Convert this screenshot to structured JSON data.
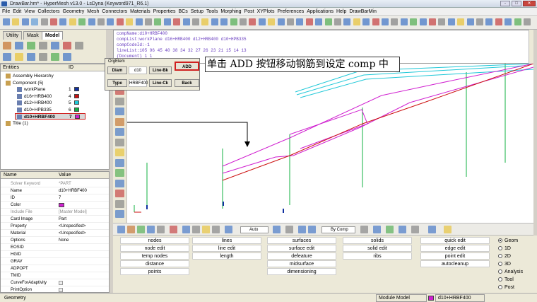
{
  "window": {
    "title": "DrawBar.hm* - HyperMesh v13.0 - LsDyna (Keyword971_R6.1)",
    "buttons": [
      "-",
      "□",
      "✕"
    ]
  },
  "menu": [
    "File",
    "Edit",
    "View",
    "Collectors",
    "Geometry",
    "Mesh",
    "Connectors",
    "Materials",
    "Properties",
    "BCs",
    "Setup",
    "Tools",
    "Morphing",
    "Post",
    "XYPlots",
    "Preferences",
    "Applications",
    "Help",
    "DrawBarMin"
  ],
  "left_tabs": [
    "Utility",
    "Mask",
    "Model"
  ],
  "entities": {
    "header": "Entities",
    "id_header": "ID",
    "items": [
      {
        "label": "Assembly Hierarchy",
        "id": "",
        "color": ""
      },
      {
        "label": "Component (5)",
        "id": "",
        "color": ""
      },
      {
        "label": "workPlane",
        "id": "1",
        "color": "#1030a0"
      },
      {
        "label": "d16+HRB400",
        "id": "4",
        "color": "#cc1010"
      },
      {
        "label": "d12+HRB400",
        "id": "5",
        "color": "#20c8d8"
      },
      {
        "label": "d10+HPB335",
        "id": "6",
        "color": "#10b040"
      },
      {
        "label": "d10+HRBF400",
        "id": "7",
        "color": "#d020d0"
      },
      {
        "label": "Title (1)",
        "id": "",
        "color": ""
      }
    ]
  },
  "properties": {
    "name_header": "Name",
    "value_header": "Value",
    "rows": [
      {
        "k": "Solver Keyword",
        "v": "*PART",
        "grey": true
      },
      {
        "k": "Name",
        "v": "d10+HRBF400",
        "grey": false
      },
      {
        "k": "ID",
        "v": "7",
        "grey": false
      },
      {
        "k": "Color",
        "v": "",
        "grey": false
      },
      {
        "k": "Include File",
        "v": "[Master Model]",
        "grey": true
      },
      {
        "k": "Card Image",
        "v": "Part",
        "grey": false
      },
      {
        "k": "Property",
        "v": "<Unspecified>",
        "grey": false
      },
      {
        "k": "Material",
        "v": "<Unspecified>",
        "grey": false
      },
      {
        "k": "Options",
        "v": "None",
        "grey": false
      },
      {
        "k": "EOSID",
        "v": "",
        "grey": false
      },
      {
        "k": "HGID",
        "v": "",
        "grey": false
      },
      {
        "k": "GRAV",
        "v": "",
        "grey": false
      },
      {
        "k": "ADPOPT",
        "v": "",
        "grey": false
      },
      {
        "k": "TMID",
        "v": "",
        "grey": false
      },
      {
        "k": "CurveForAdaptivity",
        "v": "",
        "grey": false
      },
      {
        "k": "PrintOption",
        "v": "",
        "grey": false
      }
    ]
  },
  "command": {
    "lines": [
      "compName:d10+HRBF400",
      "compList:workPlane d16+HRB400 d12+HRB400 d10+HPB335",
      "compCodeId:-1",
      "lineList:105 96 45 40 38 34 32 27 26 23 21 15 14 13",
      "{Document} 1  1"
    ]
  },
  "dialog": {
    "title": "OrgElem",
    "diam_label": "Diam",
    "diam_value": "d10",
    "lineblk_label": "Line-Bk",
    "type_label": "Type",
    "type_value": "HRBF400",
    "linechk_label": "Line-Ck",
    "add_label": "ADD",
    "back_label": "Back"
  },
  "callout": {
    "text": "单击 ADD 按钮移动钢筋到设定 comp 中"
  },
  "bottom_toolbar": {
    "auto_select": "Auto",
    "bycomp_select": "By Comp"
  },
  "panels": {
    "col1": [
      "nodes",
      "node edit",
      "temp nodes",
      "distance",
      "points"
    ],
    "col2": [
      "lines",
      "line edit",
      "length"
    ],
    "col3": [
      "surfaces",
      "surface edit",
      "defeature",
      "midsurface",
      "dimensioning"
    ],
    "col4": [
      "solids",
      "solid edit",
      "ribs"
    ],
    "col5": [
      "quick edit",
      "edge edit",
      "point edit",
      "autocleanup"
    ]
  },
  "radios": [
    {
      "label": "Geom",
      "checked": true
    },
    {
      "label": "1D",
      "checked": false
    },
    {
      "label": "2D",
      "checked": false
    },
    {
      "label": "3D",
      "checked": false
    },
    {
      "label": "Analysis",
      "checked": false
    },
    {
      "label": "Tool",
      "checked": false
    },
    {
      "label": "Post",
      "checked": false
    }
  ],
  "status": {
    "left": "Geometry",
    "model": "Module Model",
    "component": "d10+HRBF400"
  }
}
